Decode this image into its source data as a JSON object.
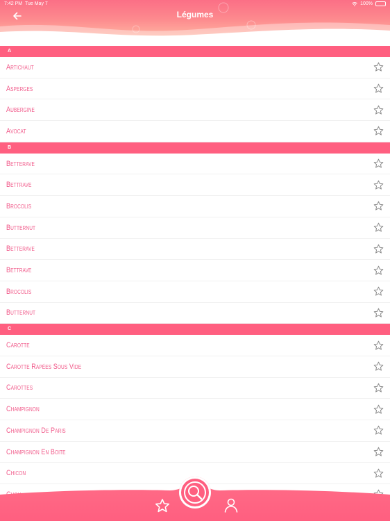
{
  "status": {
    "time": "7:42 PM",
    "date": "Tue May 7",
    "battery": "100%"
  },
  "header": {
    "title": "Légumes"
  },
  "colors": {
    "accent": "#ff5f80",
    "item_text": "#f15a8a",
    "header_top": "#fb6f86",
    "header_bottom": "#ffc3a8"
  },
  "sections": [
    {
      "letter": "A",
      "items": [
        "Artichaut",
        "Asperges",
        "Aubergine",
        "Avocat"
      ]
    },
    {
      "letter": "B",
      "items": [
        "Betterave",
        "Bettrave",
        "Brocolis",
        "Butternut",
        "Betterave",
        "Bettrave",
        "Brocolis",
        "Butternut"
      ]
    },
    {
      "letter": "C",
      "items": [
        "Carotte",
        "Carotte Rapées Sous Vide",
        "Carottes",
        "Champignon",
        "Champignon De Paris",
        "Champignon En Boite",
        "Chicon",
        "Chou"
      ]
    }
  ],
  "icons": {
    "row_action": "star-outline-icon",
    "back": "arrow-left-icon",
    "fab": "search-icon",
    "nav_left": "star-icon",
    "nav_right": "user-icon"
  }
}
